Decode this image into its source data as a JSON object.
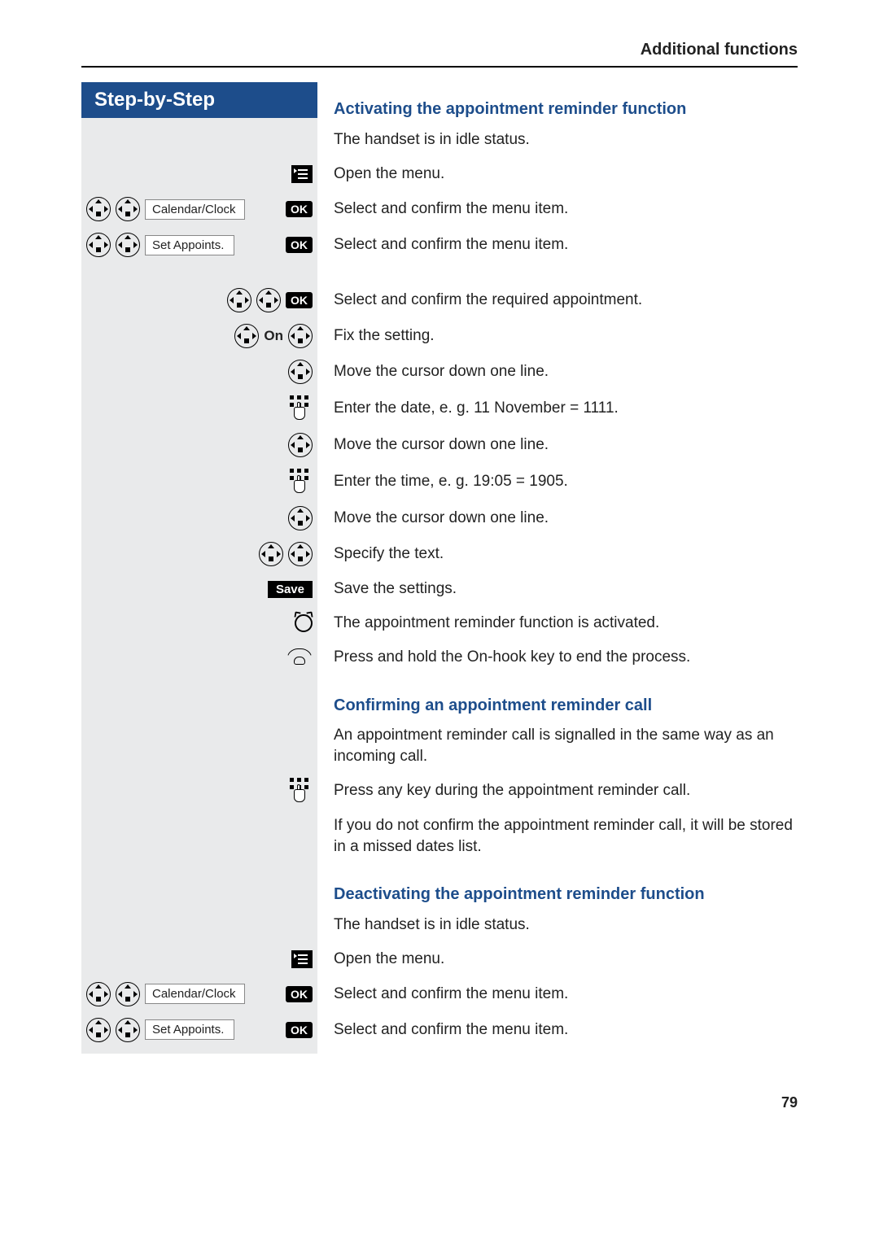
{
  "header_section": "Additional functions",
  "banner": "Step-by-Step",
  "page_number": "79",
  "labels": {
    "ok": "OK",
    "save": "Save",
    "on": "On",
    "calendar_clock": "Calendar/Clock",
    "set_appoints": "Set Appoints."
  },
  "section1": {
    "title": "Activating the appointment reminder function",
    "r_idle": "The handset is in idle status.",
    "r_open": "Open the menu.",
    "r_cal": "Select and confirm the menu item.",
    "r_set": "Select and confirm the menu item.",
    "r_sel_appt": "Select and confirm the required appointment.",
    "r_fix": "Fix the setting.",
    "r_cursor1": "Move the cursor down one line.",
    "r_date": "Enter the date, e. g. 11 November = 1111.",
    "r_cursor2": "Move the cursor down one line.",
    "r_time": "Enter the time, e. g. 19:05 = 1905.",
    "r_cursor3": "Move the cursor down one line.",
    "r_text": "Specify the text.",
    "r_save": "Save the settings.",
    "r_activated": "The appointment reminder function is activated.",
    "r_hold": "Press and hold the On-hook key to end the process."
  },
  "section2": {
    "title": "Confirming an appointment reminder call",
    "r_signal": "An appointment reminder call is signalled in the same way as an incoming call.",
    "r_press": "Press any key during the appointment reminder call.",
    "r_missed": "If you do not confirm the appointment reminder call, it will be stored in a missed dates list."
  },
  "section3": {
    "title": "Deactivating the appointment reminder function",
    "r_idle": "The handset is in idle status.",
    "r_open": "Open the menu.",
    "r_cal": "Select and confirm the menu item.",
    "r_set": "Select and confirm the menu item."
  }
}
